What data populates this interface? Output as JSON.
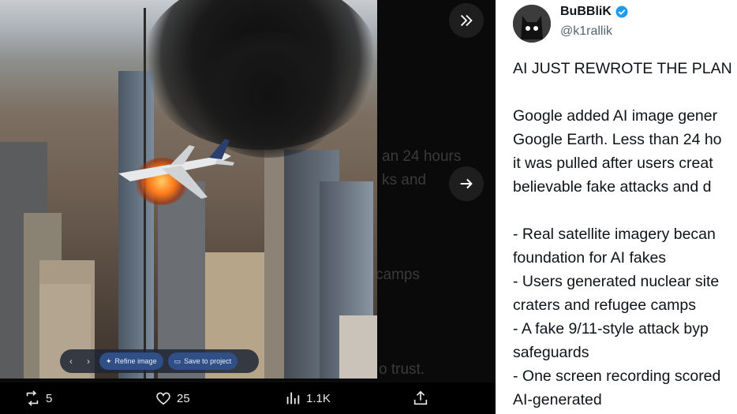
{
  "media": {
    "overlay_text": {
      "line1": "an 24 hours",
      "line2": "ks and",
      "line3": "camps",
      "line4": "o trust."
    },
    "image_toolbar": {
      "refine_label": "Refine image",
      "save_label": "Save to project"
    }
  },
  "actions": {
    "retweets": "5",
    "likes": "25",
    "views": "1.1K"
  },
  "author": {
    "name": "BuBBliK",
    "handle": "@k1rallik"
  },
  "tweet_lines": [
    "AI JUST REWROTE THE PLAN",
    "",
    "Google added AI image gener",
    "Google Earth. Less than 24 ho",
    "it was pulled after users creat",
    "believable fake attacks and d",
    "",
    "- Real satellite imagery becan",
    "foundation for AI fakes",
    "- Users generated nuclear site",
    "craters and refugee camps",
    "- A fake 9/11-style attack byp",
    "safeguards",
    "- One screen recording scored",
    "AI-generated"
  ],
  "colors": {
    "verified": "#1d9bf0",
    "pill_button": "#2f4f86",
    "text_primary": "#0f1419",
    "text_secondary": "#536471"
  },
  "icons": [
    "expand-icon",
    "next-arrow-icon",
    "retweet-icon",
    "like-icon",
    "views-icon",
    "share-icon",
    "verified-badge-icon",
    "chevron-left-icon",
    "chevron-right-icon",
    "sparkle-icon"
  ]
}
